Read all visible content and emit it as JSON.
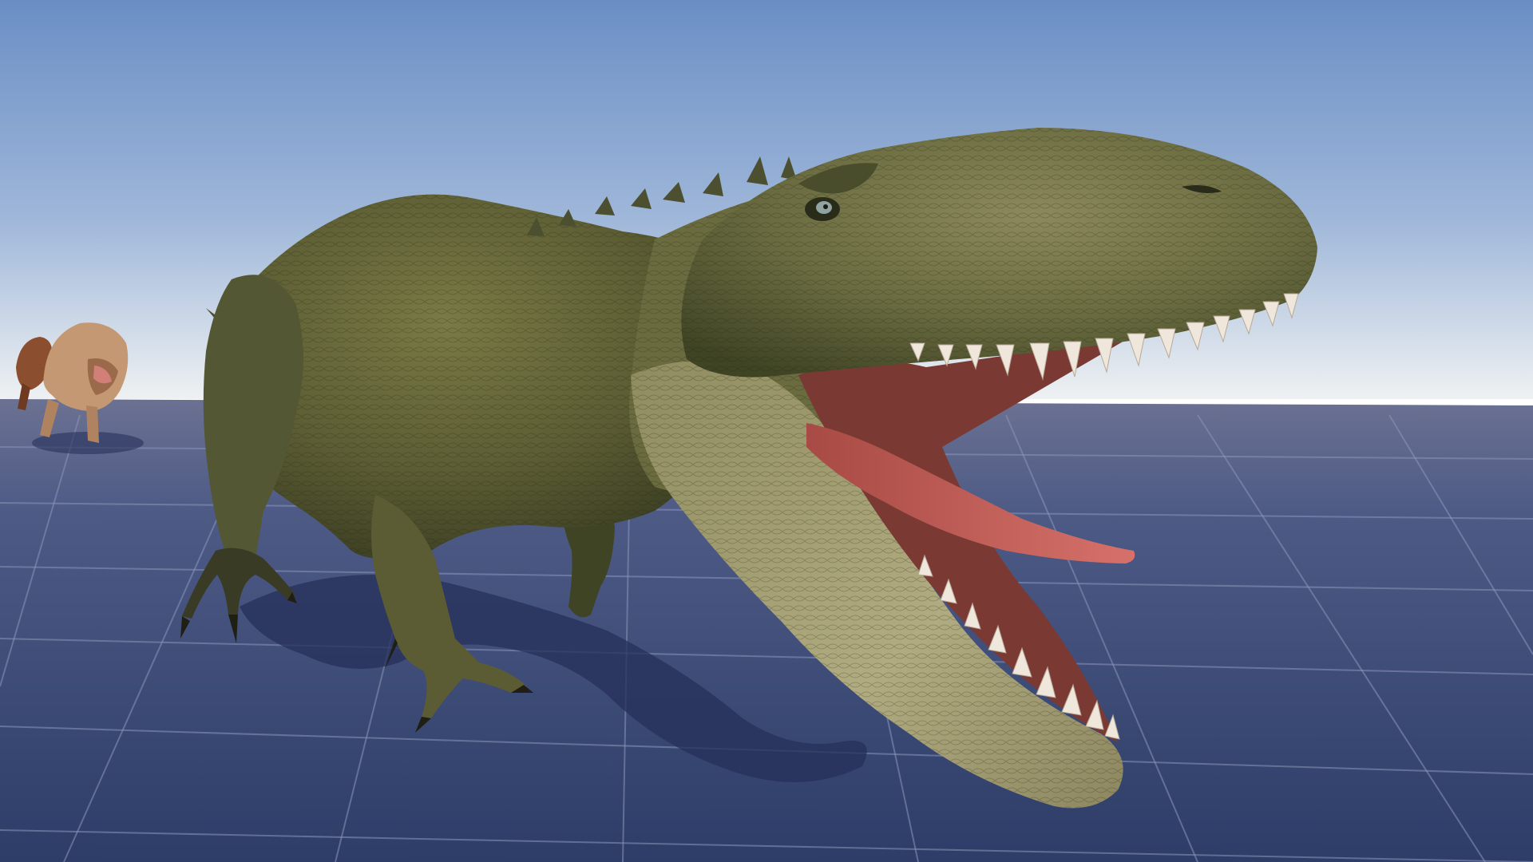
{
  "scene": {
    "colors": {
      "sky_top": "#6a8ec4",
      "sky_mid": "#9fb7d9",
      "horizon": "#eef1f2",
      "ground_far": "#6b7192",
      "ground_near": "#2d3d68",
      "grid_line": "#8a96b8",
      "dino_skin_dark": "#3f4424",
      "dino_skin_mid": "#6b6c3e",
      "dino_skin_light": "#a3a172",
      "mouth_inner": "#7a3a33",
      "tongue": "#c96560",
      "teeth": "#efe6dc",
      "shadow": "#26305a",
      "bg_dino_skin": "#c49873",
      "bg_dino_dark": "#8b4e2e"
    }
  }
}
